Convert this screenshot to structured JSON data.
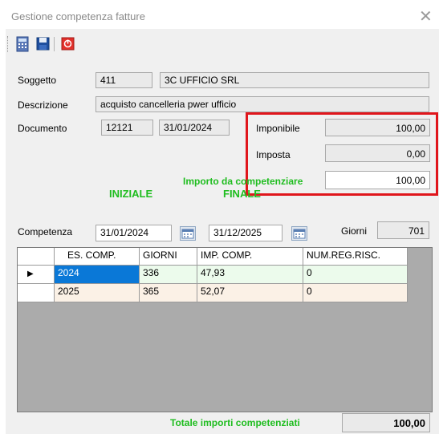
{
  "window": {
    "title": "Gestione competenza fatture"
  },
  "toolbar": {
    "icons": [
      "calculator-icon",
      "save-icon",
      "exit-icon"
    ]
  },
  "form": {
    "soggetto_label": "Soggetto",
    "soggetto_code": "411",
    "soggetto_name": "3C UFFICIO SRL",
    "descrizione_label": "Descrizione",
    "descrizione_value": "acquisto cancelleria pwer ufficio",
    "documento_label": "Documento",
    "documento_number": "12121",
    "documento_date": "31/01/2024"
  },
  "amounts": {
    "imponibile_label": "Imponibile",
    "imponibile_value": "100,00",
    "imposta_label": "Imposta",
    "imposta_value": "0,00",
    "importo_label": "Importo da competenziare",
    "importo_value": "100,00"
  },
  "competenza": {
    "label": "Competenza",
    "iniziale_label": "INIZIALE",
    "iniziale_value": "31/01/2024",
    "finale_label": "FINALE",
    "finale_value": "31/12/2025",
    "giorni_label": "Giorni",
    "giorni_value": "701"
  },
  "grid": {
    "columns": [
      "ES. COMP.",
      "GIORNI",
      "IMP. COMP.",
      "NUM.REG.RISC."
    ],
    "rows": [
      {
        "es": "2024",
        "giorni": "336",
        "imp": "47,93",
        "num": "0"
      },
      {
        "es": "2025",
        "giorni": "365",
        "imp": "52,07",
        "num": "0"
      }
    ],
    "current_row_marker": "▶"
  },
  "footer": {
    "totale_label": "Totale importi competenziati",
    "totale_value": "100,00"
  },
  "colors": {
    "accent_green": "#1fbd1f",
    "highlight_red": "#e0161c",
    "selected_blue": "#0a78d7"
  }
}
